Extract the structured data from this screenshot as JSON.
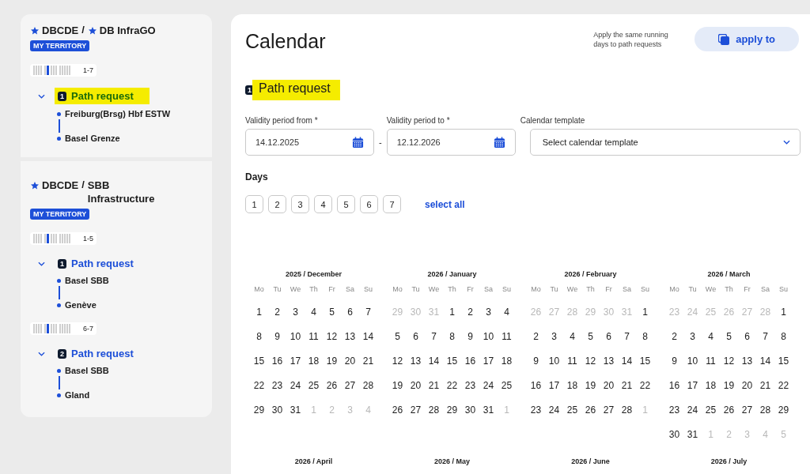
{
  "sidebar": {
    "territories": [
      {
        "operators": [
          {
            "name": "DBCDE",
            "starred": true
          },
          {
            "name": "DB InfraGO",
            "starred": true
          }
        ],
        "separator": "/",
        "badge": "MY TERRITORY",
        "groups": [
          {
            "days": "1-7",
            "requests": [
              {
                "number": "1",
                "label": "Path request",
                "highlighted": true,
                "expanded": true,
                "stops": [
                  "Freiburg(Brsg) Hbf ESTW",
                  "Basel Grenze"
                ]
              }
            ]
          }
        ]
      },
      {
        "operators": [
          {
            "name": "DBCDE",
            "starred": true
          },
          {
            "name": "SBB Infrastructure",
            "starred": false
          }
        ],
        "separator": "/",
        "badge": "MY TERRITORY",
        "groups": [
          {
            "days": "1-5",
            "requests": [
              {
                "number": "1",
                "label": "Path request",
                "highlighted": false,
                "expanded": true,
                "stops": [
                  "Basel SBB",
                  "Genève"
                ]
              }
            ]
          },
          {
            "days": "6-7",
            "requests": [
              {
                "number": "2",
                "label": "Path request",
                "highlighted": false,
                "expanded": true,
                "stops": [
                  "Basel SBB",
                  "Gland"
                ]
              }
            ]
          }
        ]
      }
    ]
  },
  "main": {
    "title": "Calendar",
    "apply_hint": "Apply the same running days to path requests",
    "apply_button": "apply to",
    "section": {
      "number": "1",
      "title": "Path request",
      "highlighted": true
    },
    "validity_from": {
      "label": "Validity period from *",
      "value": "14.12.2025"
    },
    "range_separator": "-",
    "validity_to": {
      "label": "Validity period to *",
      "value": "12.12.2026"
    },
    "calendar_template": {
      "label": "Calendar template",
      "value": "Select calendar template"
    },
    "days_label": "Days",
    "day_buttons": [
      {
        "label": "1",
        "selected": false
      },
      {
        "label": "2",
        "selected": false
      },
      {
        "label": "3",
        "selected": false
      },
      {
        "label": "4",
        "selected": false
      },
      {
        "label": "5",
        "selected": false
      },
      {
        "label": "6",
        "selected": false
      },
      {
        "label": "7",
        "selected": false
      }
    ],
    "select_all": "select all",
    "months": [
      {
        "title": "2025 / December",
        "weekdays": [
          "Mo",
          "Tu",
          "We",
          "Th",
          "Fr",
          "Sa",
          "Su"
        ],
        "days": [
          "1",
          "2",
          "3",
          "4",
          "5",
          "6",
          "7",
          "8",
          "9",
          "10",
          "11",
          "12",
          "13",
          "14",
          "15",
          "16",
          "17",
          "18",
          "19",
          "20",
          "21",
          "22",
          "23",
          "24",
          "25",
          "26",
          "27",
          "28",
          "29",
          "30",
          "31"
        ],
        "next_days": [
          "1",
          "2",
          "3",
          "4"
        ]
      },
      {
        "title": "2026 / January",
        "weekdays": [
          "Mo",
          "Tu",
          "We",
          "Th",
          "Fr",
          "Sa",
          "Su"
        ],
        "prev_days": [
          "29",
          "30",
          "31"
        ],
        "days": [
          "1",
          "2",
          "3",
          "4",
          "5",
          "6",
          "7",
          "8",
          "9",
          "10",
          "11",
          "12",
          "13",
          "14",
          "15",
          "16",
          "17",
          "18",
          "19",
          "20",
          "21",
          "22",
          "23",
          "24",
          "25",
          "26",
          "27",
          "28",
          "29",
          "30",
          "31"
        ],
        "next_days": [
          "1"
        ]
      },
      {
        "title": "2026 / February",
        "weekdays": [
          "Mo",
          "Tu",
          "We",
          "Th",
          "Fr",
          "Sa",
          "Su"
        ],
        "prev_days": [
          "26",
          "27",
          "28",
          "29",
          "30",
          "31"
        ],
        "days": [
          "1",
          "2",
          "3",
          "4",
          "5",
          "6",
          "7",
          "8",
          "9",
          "10",
          "11",
          "12",
          "13",
          "14",
          "15",
          "16",
          "17",
          "18",
          "19",
          "20",
          "21",
          "22",
          "23",
          "24",
          "25",
          "26",
          "27",
          "28"
        ],
        "next_days": [
          "1"
        ]
      },
      {
        "title": "2026 / March",
        "weekdays": [
          "Mo",
          "Tu",
          "We",
          "Th",
          "Fr",
          "Sa",
          "Su"
        ],
        "prev_days": [
          "23",
          "24",
          "25",
          "26",
          "27",
          "28"
        ],
        "days": [
          "1",
          "2",
          "3",
          "4",
          "5",
          "6",
          "7",
          "8",
          "9",
          "10",
          "11",
          "12",
          "13",
          "14",
          "15",
          "16",
          "17",
          "18",
          "19",
          "20",
          "21",
          "22",
          "23",
          "24",
          "25",
          "26",
          "27",
          "28",
          "29",
          "30",
          "31"
        ],
        "next_days": [
          "1",
          "2",
          "3",
          "4",
          "5"
        ]
      },
      {
        "title": "2026 / April"
      },
      {
        "title": "2026 / May"
      },
      {
        "title": "2026 / June"
      },
      {
        "title": "2026 / July"
      }
    ]
  }
}
